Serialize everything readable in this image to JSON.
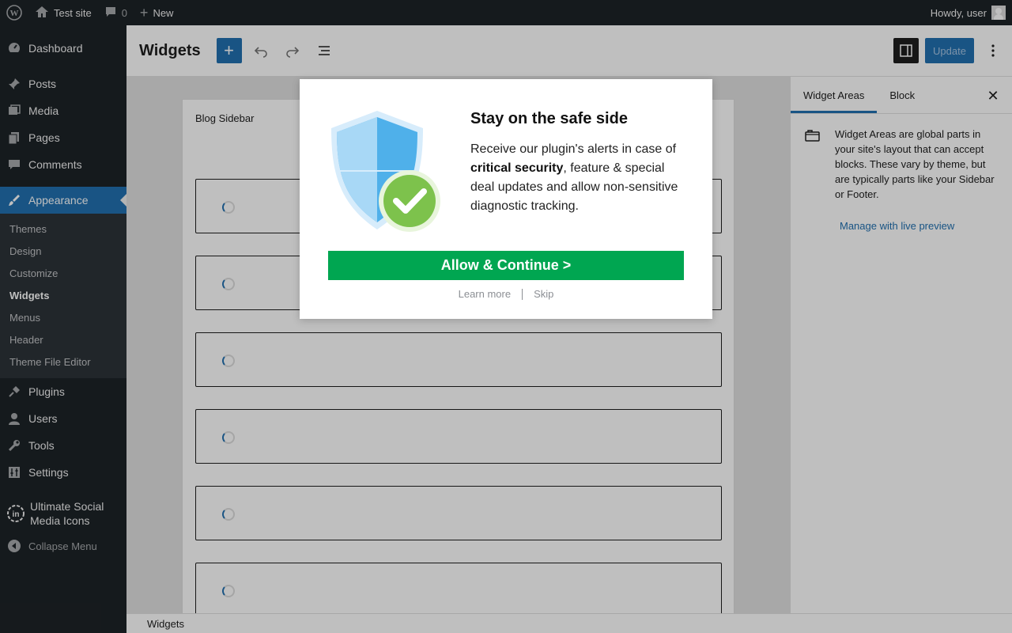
{
  "adminbar": {
    "site_name": "Test site",
    "comments_count": "0",
    "new_label": "New",
    "howdy": "Howdy, user"
  },
  "menu": {
    "dashboard": "Dashboard",
    "posts": "Posts",
    "media": "Media",
    "pages": "Pages",
    "comments": "Comments",
    "appearance": "Appearance",
    "submenu": [
      "Themes",
      "Design",
      "Customize",
      "Widgets",
      "Menus",
      "Header",
      "Theme File Editor"
    ],
    "plugins": "Plugins",
    "users": "Users",
    "tools": "Tools",
    "settings": "Settings",
    "usmi_line1": "Ultimate Social",
    "usmi_line2": "Media Icons",
    "collapse": "Collapse Menu"
  },
  "header": {
    "title": "Widgets",
    "update": "Update"
  },
  "canvas": {
    "area_title": "Blog Sidebar"
  },
  "inspector": {
    "tab_areas": "Widget Areas",
    "tab_block": "Block",
    "description": "Widget Areas are global parts in your site's layout that can accept blocks. These vary by theme, but are typically parts like your Sidebar or Footer.",
    "link": "Manage with live preview"
  },
  "footer": {
    "breadcrumb": "Widgets"
  },
  "modal": {
    "title": "Stay on the safe side",
    "text_1": "Receive our plugin's alerts in case of ",
    "text_bold": "critical security",
    "text_2": ", feature & special deal updates and allow non-sensitive diagnostic tracking.",
    "allow": "Allow & Continue >",
    "learn_more": "Learn more",
    "skip": "Skip"
  },
  "colors": {
    "accent": "#2271b1",
    "allow_green": "#00a651",
    "admin_dark": "#1d2327"
  }
}
